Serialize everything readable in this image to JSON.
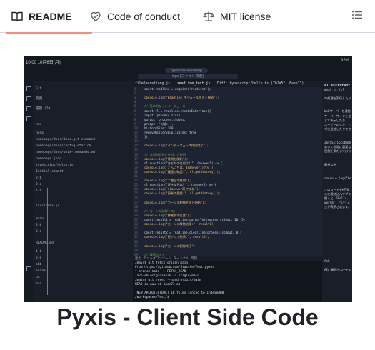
{
  "tabs": {
    "readme": "README",
    "code_of_conduct": "Code of conduct",
    "license": "MIT license"
  },
  "screenshot": {
    "status_time": "10:00  10月6日(月)",
    "battery": "92%",
    "url": "pyxis-code.vercel.app",
    "search_placeholder": "type [ファイル検索]",
    "editor_tabs": [
      "fileOperationg.js",
      "readline_test.js",
      "Diff: typescript/hello.ts (7b2a5f..6aee73)"
    ],
    "sidebar_rows": [
      "Git",
      "変更",
      "履歴 (20)",
      "nav",
      "help",
      "homepage/docs/docs.git-command",
      "homepage/docs/config-staticm",
      "homepage/docs/unix-commands.md",
      "homepage.json",
      "typescript/hello.ts",
      "Initial commit",
      "2-b",
      "2-a",
      "1-b",
      "src/index.js",
      "main",
      "2-b",
      "2-a",
      "README.md",
      "1-b",
      "2-e",
      "bbb",
      "aaaaa",
      "ba",
      "aaa"
    ],
    "code_lines": [
      "const readline = require('readline');",
      "",
      "console.log(\"Readline モジュールテスト開始\");",
      "",
      "// 基本的なインターフェース",
      "const rl = readline.createInterface({",
      "  input: process.stdin,",
      "  output: process.stdout,",
      "  prompt: '対話> ',",
      "  historySize: 100,",
      "  removeHistoryDuplicates: true",
      "});",
      "",
      "console.log(\"インターフェース作成完了\");",
      "",
      "// 非同期処理を使用した質問",
      "console.log(\"質問を開始\");",
      "rl.question(\"あなたの名前は？\", (answer1) => {",
      "  console.log(`こんにちは、${answer1}さん`);",
      "  console.log(\"履歴の確認:\", rl.getHistory());",
      "",
      "  console.log(\"二番目の質問\");",
      "  rl.question(\"好きな色は？\", (answer2) => {",
      "    console.log(`${answer2}ですね`);",
      "    console.log(\"更新の履歴:\", rl.getHistory());",
      "",
      "    console.log(\"カーソル制御テスト開始\");",
      "",
      "    // カーソル制御テスト",
      "    console.log(\"移動前の位置\");",
      "    const result1 = readline.cursorTo(process.stdout, 10, 5);",
      "    console.log(\"カーソル移動結果:\", result1);",
      "",
      "    const result2 = readline.clearLine(process.stdout, 0);",
      "    console.log(\"行クリア結果:\", result2);",
      "",
      "    console.log(\"カーソル制御終了\");",
      "",
      "    // 履歴テスト",
      "    console.log(\"最終履歴:\", rl.getHistory());"
    ],
    "terminal_lines": [
      "出力   デバッグコンソール   ターミナル   問題",
      "/main$ git fetch origin main",
      "From https://github.com/Stasshe/Test-pyxis",
      " * branch          main       -> FETCH_HEAD",
      "   1a2b3e0         origin/main -> origin/main",
      "/main$ git reset --hard origin/main",
      "HEAD is now at 6aee73 aa",
      "",
      "[NEW ARCHITECTURE] 18 files synced to IndexedDB",
      "/workspaces/Test/$"
    ],
    "ai_lines": [
      "AI Assistant",
      "what is js?",
      "の処理を実行したりできます。",
      "Webサーバーを通信:",
      "サーバーサイドを処理",
      "して表示したり、",
      "ユーザーのしたことでウェ",
      "ブに送信したりできます。",
      "JavaScriptはWeb開発に",
      "おいて非常に重要な",
      "役割を果たしており、",
      "簡単な例",
      "console.log(\"Hello, world!\");",
      "このコードをHTMLファイ",
      "ルに埋め込んでブラウザで",
      "開くと、「Hello,",
      "world!」というメッセー",
      "ジが表示されます。",
      "Ask",
      "AIに質問やコードの相談をしてください..."
    ]
  },
  "heading": "Pyxis - Client Side Code"
}
